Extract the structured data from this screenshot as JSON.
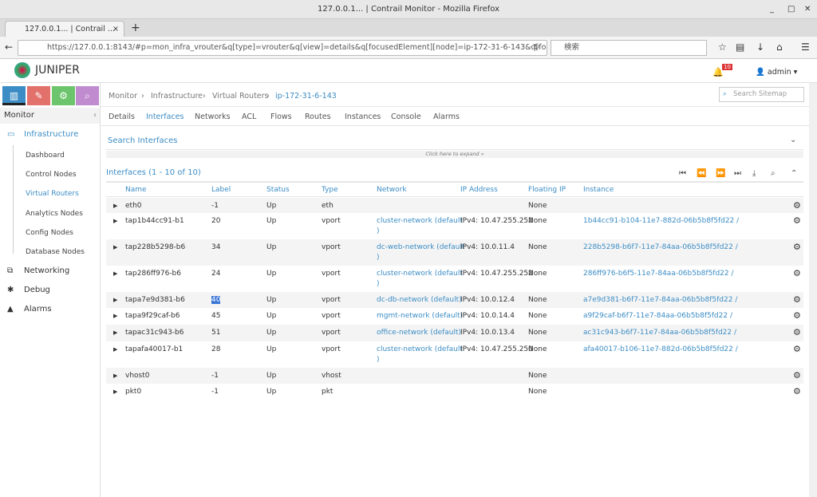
{
  "window": {
    "title": "127.0.0.1... | Contrail Monitor - Mozilla Firefox",
    "tab_title": "127.0.0.1... | Contrail ...",
    "url": "https://127.0.0.1:8143/#p=mon_infra_vrouter&q[type]=vrouter&q[view]=details&q[focusedElement][node]=ip-172-31-6-143&q[fo",
    "search_placeholder": "検索"
  },
  "header": {
    "logo": "JUNIPER",
    "alarm_count": "10",
    "user": "admin"
  },
  "sidebar": {
    "title": "Monitor",
    "sections": [
      {
        "label": "Infrastructure",
        "items": [
          "Dashboard",
          "Control Nodes",
          "Virtual Routers",
          "Analytics Nodes",
          "Config Nodes",
          "Database Nodes"
        ]
      },
      {
        "label": "Networking"
      },
      {
        "label": "Debug"
      },
      {
        "label": "Alarms"
      }
    ]
  },
  "breadcrumb": [
    "Monitor",
    "Infrastructure",
    "Virtual Routers",
    "ip-172-31-6-143"
  ],
  "sitemap_placeholder": "Search Sitemap",
  "tabs": [
    "Details",
    "Interfaces",
    "Networks",
    "ACL",
    "Flows",
    "Routes",
    "Instances",
    "Console",
    "Alarms"
  ],
  "active_tab": "Interfaces",
  "search_panel": {
    "title": "Search Interfaces",
    "expand": "Click here to expand »"
  },
  "grid": {
    "title": "Interfaces (1 - 10 of 10)",
    "columns": [
      "Name",
      "Label",
      "Status",
      "Type",
      "Network",
      "IP Address",
      "Floating IP",
      "Instance"
    ],
    "rows": [
      {
        "name": "eth0",
        "label": "-1",
        "status": "Up",
        "type": "eth",
        "network": "",
        "ip": "",
        "fip": "None",
        "instance": ""
      },
      {
        "name": "tap1b44cc91-b1",
        "label": "20",
        "status": "Up",
        "type": "vport",
        "network": "cluster-network (default",
        "network2": ")",
        "ip": "IPv4: 10.47.255.252",
        "fip": "None",
        "instance": "1b44cc91-b104-11e7-882d-06b5b8f5fd22 /"
      },
      {
        "name": "tap228b5298-b6",
        "label": "34",
        "status": "Up",
        "type": "vport",
        "network": "dc-web-network (default",
        "network2": ")",
        "ip": "IPv4: 10.0.11.4",
        "fip": "None",
        "instance": "228b5298-b6f7-11e7-84aa-06b5b8f5fd22 /"
      },
      {
        "name": "tap286ff976-b6",
        "label": "24",
        "status": "Up",
        "type": "vport",
        "network": "cluster-network (default",
        "network2": ")",
        "ip": "IPv4: 10.47.255.252",
        "fip": "None",
        "instance": "286ff976-b6f5-11e7-84aa-06b5b8f5fd22 /"
      },
      {
        "name": "tapa7e9d381-b6",
        "label": "40",
        "status": "Up",
        "type": "vport",
        "network": "dc-db-network (default)",
        "ip": "IPv4: 10.0.12.4",
        "fip": "None",
        "instance": "a7e9d381-b6f7-11e7-84aa-06b5b8f5fd22 /"
      },
      {
        "name": "tapa9f29caf-b6",
        "label": "45",
        "status": "Up",
        "type": "vport",
        "network": "mgmt-network (default)",
        "ip": "IPv4: 10.0.14.4",
        "fip": "None",
        "instance": "a9f29caf-b6f7-11e7-84aa-06b5b8f5fd22 /"
      },
      {
        "name": "tapac31c943-b6",
        "label": "51",
        "status": "Up",
        "type": "vport",
        "network": "office-network (default)",
        "ip": "IPv4: 10.0.13.4",
        "fip": "None",
        "instance": "ac31c943-b6f7-11e7-84aa-06b5b8f5fd22 /"
      },
      {
        "name": "tapafa40017-b1",
        "label": "28",
        "status": "Up",
        "type": "vport",
        "network": "cluster-network (default",
        "network2": ")",
        "ip": "IPv4: 10.47.255.250",
        "fip": "None",
        "instance": "afa40017-b106-11e7-882d-06b5b8f5fd22 /"
      },
      {
        "name": "vhost0",
        "label": "-1",
        "status": "Up",
        "type": "vhost",
        "network": "",
        "ip": "",
        "fip": "None",
        "instance": ""
      },
      {
        "name": "pkt0",
        "label": "-1",
        "status": "Up",
        "type": "pkt",
        "network": "",
        "ip": "",
        "fip": "None",
        "instance": ""
      }
    ]
  },
  "colors": {
    "accent": "#3c8dc5",
    "btn_monitor": "#3c8dc5",
    "btn_config": "#e2706b",
    "btn_settings": "#6cc46c",
    "btn_query": "#c08ccf",
    "selection": "#3875d7"
  }
}
